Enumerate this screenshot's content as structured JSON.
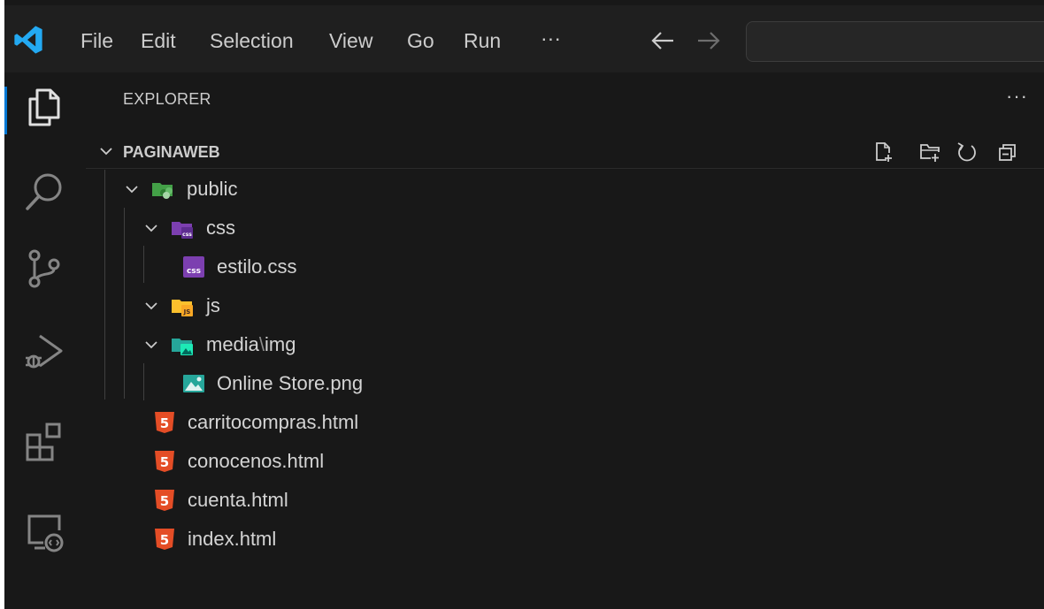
{
  "menu": {
    "items": [
      "File",
      "Edit",
      "Selection",
      "View",
      "Go",
      "Run",
      "···"
    ]
  },
  "nav": {
    "back_icon": "arrow-left-icon",
    "forward_icon": "arrow-right-icon"
  },
  "sidebar": {
    "title": "EXPLORER",
    "more": "···",
    "section_title": "PAGINAWEB",
    "actions": [
      "new-file-icon",
      "new-folder-icon",
      "refresh-icon",
      "collapse-all-icon"
    ]
  },
  "tree": {
    "public": "public",
    "css": "css",
    "estilo": "estilo.css",
    "js": "js",
    "media_a": "media",
    "media_sep": "\\",
    "media_b": "img",
    "online_store": "Online Store.png",
    "carrito": "carritocompras.html",
    "conocenos": "conocenos.html",
    "cuenta": "cuenta.html",
    "index": "index.html"
  },
  "colors": {
    "background": "#181818",
    "accent": "#0078d4",
    "vscode_logo": "#23a9f2",
    "html_icon": "#e44d26",
    "css_icon": "#7c3fb0",
    "image_icon": "#26a69a",
    "js_folder": "#fbc02d",
    "public_folder": "#43a047"
  }
}
